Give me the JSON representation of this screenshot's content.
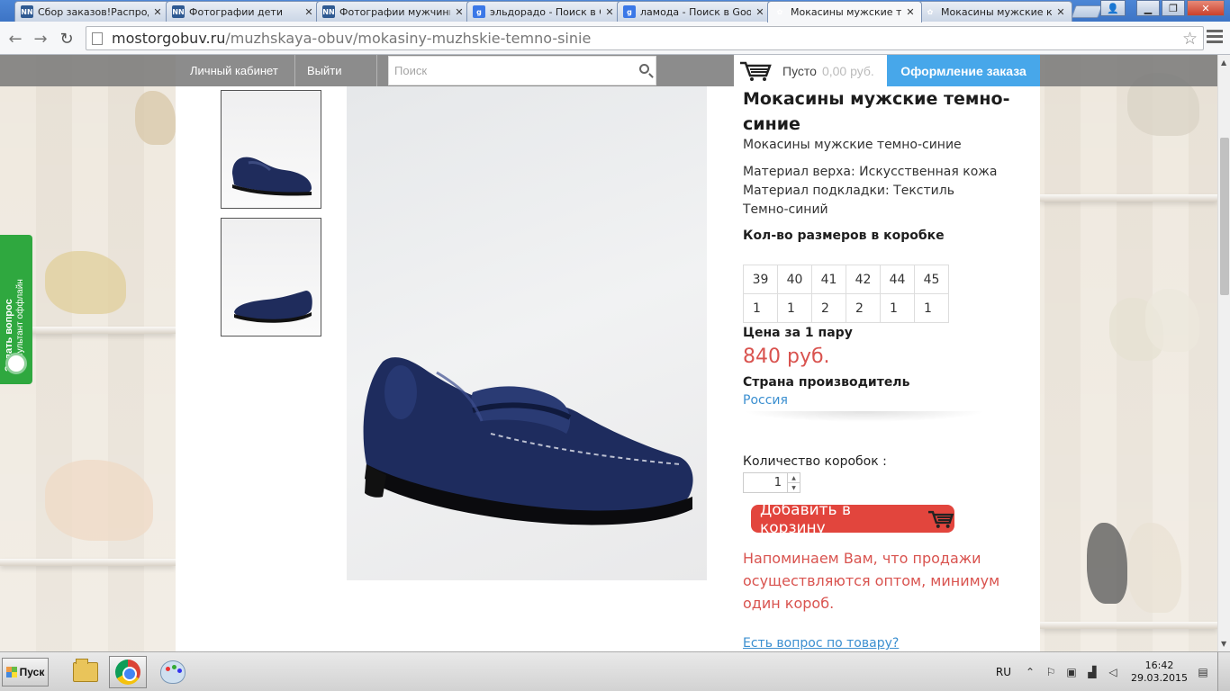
{
  "browser": {
    "tabs": [
      {
        "title": "Сбор заказов!Распродажа",
        "icon": "nn-icon",
        "active": false
      },
      {
        "title": "Фотографии дети",
        "icon": "nn-icon",
        "active": false
      },
      {
        "title": "Фотографии мужчины",
        "icon": "nn-icon",
        "active": false
      },
      {
        "title": "эльдорадо - Поиск в Google",
        "icon": "google-icon",
        "active": false
      },
      {
        "title": "ламода - Поиск в Google",
        "icon": "google-icon",
        "active": false
      },
      {
        "title": "Мокасины мужские темно-синие",
        "icon": "flower-icon",
        "active": true
      },
      {
        "title": "Мокасины мужские коричневые",
        "icon": "flower-icon",
        "active": false
      }
    ],
    "url_domain": "mostorgobuv.ru",
    "url_path": "/muzhskaya-obuv/mokasiny-muzhskie-temno-sinie"
  },
  "header": {
    "account_label": "Личный кабинет",
    "logout_label": "Выйти",
    "search_placeholder": "Поиск",
    "cart_status": "Пусто",
    "cart_sum": "0,00 руб.",
    "checkout_label": "Оформление заказа"
  },
  "consultant": {
    "line1": "Задать вопрос",
    "line2": "консультант оффлайн"
  },
  "product": {
    "title": "Мокасины мужские темно-синие",
    "subtitle": "Мокасины мужские темно-синие",
    "specs": [
      "Материал верха: Искусственная кожа",
      "Материал подкладки: Текстиль",
      "Темно-синий"
    ],
    "sizes_label": "Кол-во размеров в коробке",
    "sizes": [
      "39",
      "40",
      "41",
      "42",
      "44",
      "45"
    ],
    "quantities": [
      "1",
      "1",
      "2",
      "2",
      "1",
      "1"
    ],
    "price_label": "Цена за 1 пару",
    "price": "840 руб.",
    "country_label": "Страна производитель",
    "country": "Россия",
    "boxes_label": "Количество коробок :",
    "boxes_value": "1",
    "add_to_cart_label": "Добавить в корзину",
    "notice": "Напоминаем Вам, что продажи осуществляются оптом, минимум один короб.",
    "question_link": "Есть вопрос по товару?"
  },
  "taskbar": {
    "start_label": "Пуск",
    "language": "RU",
    "time": "16:42",
    "date": "29.03.2015"
  },
  "colors": {
    "accent_blue": "#47a7ea",
    "price_red": "#d9534f",
    "add_button": "#e2453d",
    "consultant_green": "#2fa83f",
    "link_blue": "#3b8fd0"
  }
}
